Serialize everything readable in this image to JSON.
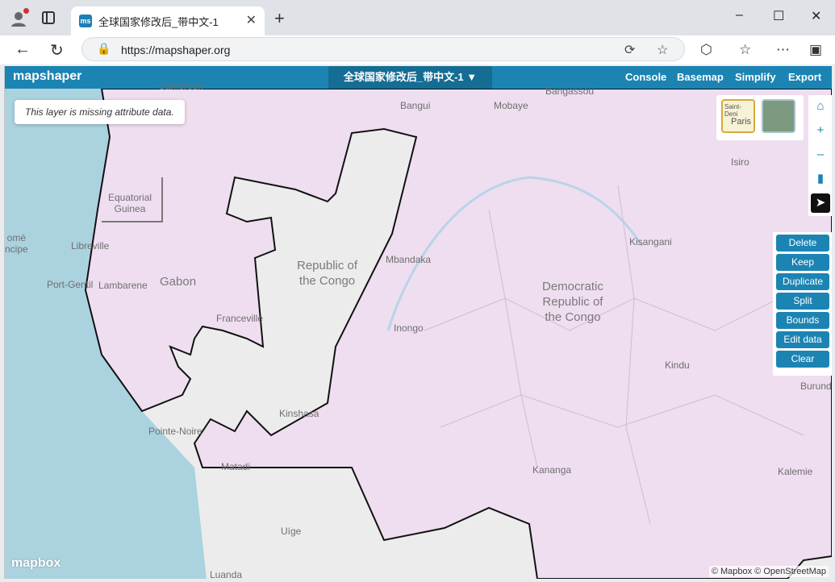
{
  "browser": {
    "tab_title": "全球国家修改后_带中文-1",
    "url": "https://mapshaper.org",
    "new_tab": "+",
    "window_controls": [
      "–",
      "☐",
      "✕"
    ]
  },
  "app": {
    "logo": "mapshaper",
    "layer_name": "全球国家修改后_带中文-1 ▼",
    "menu": [
      "Console",
      "Basemap",
      "Simplify",
      "Export"
    ]
  },
  "message": "This layer is missing attribute data.",
  "basemap_thumb_labels": [
    "Saint-Deni",
    "Paris"
  ],
  "edit_buttons": [
    "Delete",
    "Keep",
    "Duplicate",
    "Split",
    "Bounds",
    "Edit data",
    "Clear"
  ],
  "map_labels": {
    "cameroon": "Cameroon",
    "bangui": "Bangui",
    "mobaye": "Mobaye",
    "bangassou": "Bangassou",
    "equatorial_guinea": "Equatorial\nGuinea",
    "libreville": "Libreville",
    "sao_tome": "omé\nncipe",
    "gabon": "Gabon",
    "lambarene": "Lambarene",
    "port_gentil": "Port-Gentil",
    "franceville": "Franceville",
    "republic_congo": "Republic of\nthe Congo",
    "mbandaka": "Mbandaka",
    "inongo": "Inongo",
    "drc": "Democratic\nRepublic of\nthe Congo",
    "kisangani": "Kisangani",
    "isiro": "Isiro",
    "kindu": "Kindu",
    "burundi": "Burund",
    "kinshasa": "Kinshasa",
    "pointe_noire": "Pointe-Noire",
    "matadi": "Matadi",
    "kananga": "Kananga",
    "kalemie": "Kalemie",
    "uige": "Uíge",
    "luanda": "Luanda"
  },
  "mapbox_logo": "mapbox",
  "attribution": "© Mapbox © OpenStreetMap",
  "colors": {
    "header": "#1b84b3",
    "layer_fill": "#efdeef",
    "water": "#aad3df",
    "land": "#ececec"
  }
}
